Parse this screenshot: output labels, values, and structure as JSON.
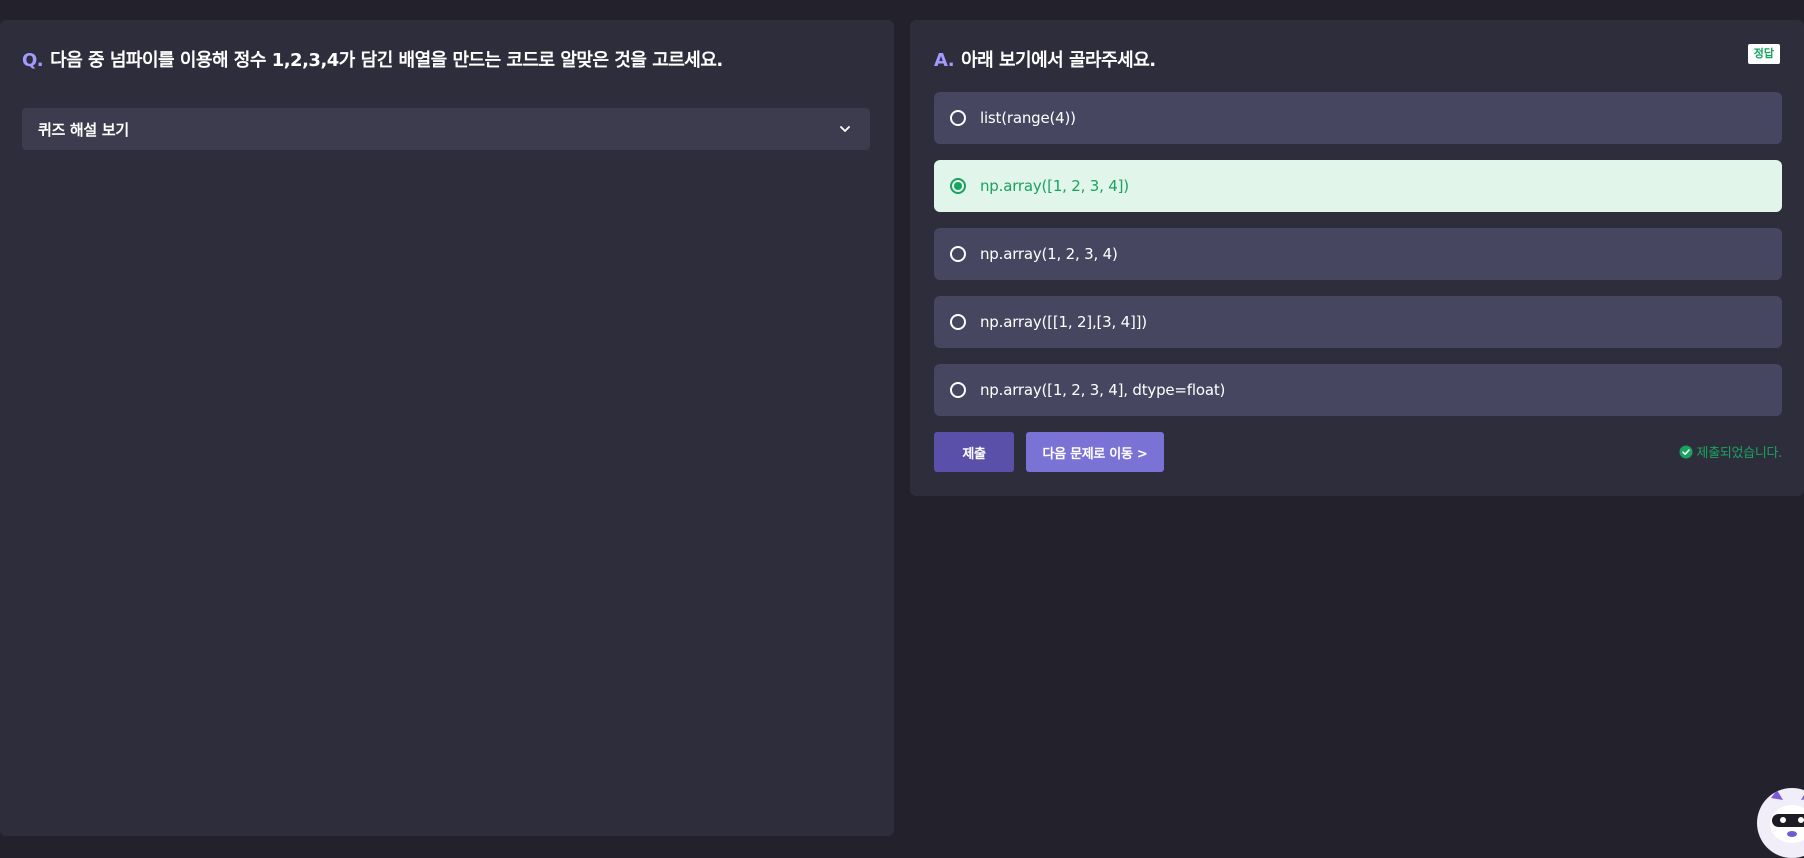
{
  "question": {
    "prefix": "Q.",
    "text": "다음 중 넘파이를 이용해 정수 1,2,3,4가 담긴 배열을 만드는 코드로 알맞은 것을 고르세요.",
    "explanation_toggle_label": "퀴즈 해설 보기",
    "explanation_icon": "chevron-down-icon"
  },
  "answer": {
    "prefix": "A.",
    "text": "아래 보기에서 골라주세요.",
    "badge": "정답",
    "options": [
      {
        "label": "list(range(4))",
        "selected": false
      },
      {
        "label": "np.array([1, 2, 3, 4])",
        "selected": true
      },
      {
        "label": "np.array(1, 2, 3, 4)",
        "selected": false
      },
      {
        "label": "np.array([[1, 2],[3, 4]])",
        "selected": false
      },
      {
        "label": "np.array([1, 2, 3, 4], dtype=float)",
        "selected": false
      }
    ],
    "submit_label": "제출",
    "next_label": "다음 문제로 이동 >",
    "status_text": "제출되었습니다.",
    "status_icon": "check-circle-icon"
  },
  "colors": {
    "background": "#22212c",
    "panel": "#2e2d3c",
    "option": "#474660",
    "selected_option": "#e2f5ea",
    "accent": "#a29bfe",
    "success": "#1aa260",
    "submit_button": "#5a4fa9",
    "next_button": "#7b72d6"
  },
  "mascot": {
    "icon": "panda-mascot-icon"
  }
}
